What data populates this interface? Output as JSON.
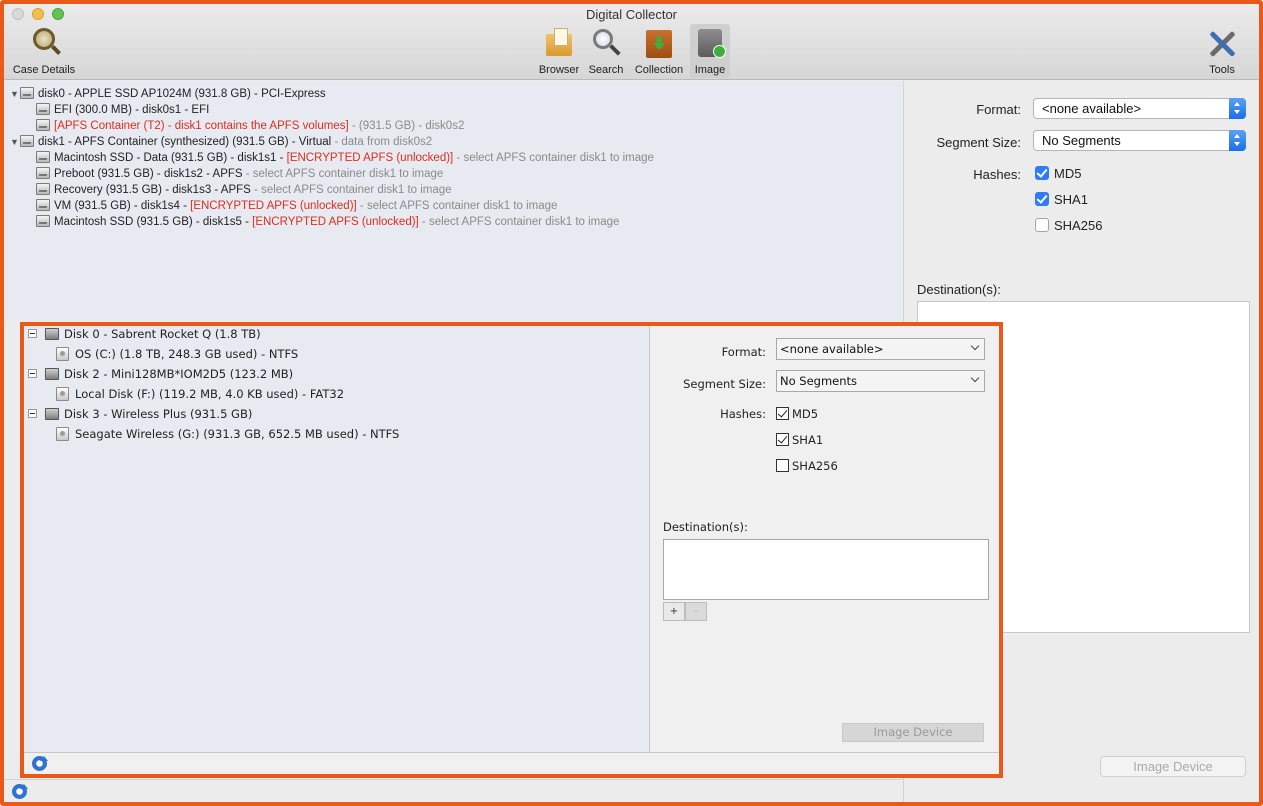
{
  "window": {
    "title": "Digital Collector"
  },
  "toolbar": {
    "case_details": "Case Details",
    "browser": "Browser",
    "search": "Search",
    "collection": "Collection",
    "image": "Image",
    "tools": "Tools",
    "active": "image"
  },
  "mac_tree": {
    "disk0": "disk0 - APPLE SSD AP1024M (931.8 GB) - PCI-Express",
    "efi": "EFI (300.0 MB) - disk0s1 - EFI",
    "apfs_container_red": "[APFS Container (T2) - disk1 contains the APFS volumes]",
    "apfs_container_gray": " -  (931.5 GB) - disk0s2",
    "disk1": "disk1 - APFS Container (synthesized) (931.5 GB) - Virtual",
    "disk1_gray": " - data from disk0s2",
    "rows": [
      {
        "main": "Macintosh SSD - Data (931.5 GB) - disk1s1 - ",
        "red": "[ENCRYPTED APFS (unlocked)]",
        "gray": " - select APFS container disk1 to image"
      },
      {
        "main": "Preboot (931.5 GB) - disk1s2 - APFS",
        "red": "",
        "gray": " - select APFS container disk1 to image"
      },
      {
        "main": "Recovery (931.5 GB) - disk1s3 - APFS",
        "red": "",
        "gray": " - select APFS container disk1 to image"
      },
      {
        "main": "VM (931.5 GB) - disk1s4 - ",
        "red": "[ENCRYPTED APFS (unlocked)]",
        "gray": " - select APFS container disk1 to image"
      },
      {
        "main": "Macintosh SSD (931.5 GB) - disk1s5 - ",
        "red": "[ENCRYPTED APFS (unlocked)]",
        "gray": " - select APFS container disk1 to image"
      }
    ]
  },
  "mac_form": {
    "format_label": "Format:",
    "format_value": "<none available>",
    "segment_label": "Segment Size:",
    "segment_value": "No Segments",
    "hashes_label": "Hashes:",
    "md5": "MD5",
    "sha1": "SHA1",
    "sha256": "SHA256",
    "destinations_label": "Destination(s):",
    "image_device": "Image Device"
  },
  "win_tree": {
    "disk0": "Disk 0 - Sabrent Rocket Q (1.8 TB)",
    "vol_c": "OS (C:) (1.8 TB, 248.3 GB used) - NTFS",
    "disk2": "Disk 2 - Mini128MB*IOM2D5 (123.2 MB)",
    "vol_f": "Local Disk (F:) (119.2 MB, 4.0 KB used) - FAT32",
    "disk3": "Disk 3 - Wireless Plus (931.5 GB)",
    "vol_g": "Seagate Wireless (G:) (931.3 GB, 652.5 MB used) - NTFS"
  },
  "win_form": {
    "format_label": "Format:",
    "format_value": "<none available>",
    "segment_label": "Segment Size:",
    "segment_value": "No Segments",
    "hashes_label": "Hashes:",
    "md5": "MD5",
    "sha1": "SHA1",
    "sha256": "SHA256",
    "destinations_label": "Destination(s):",
    "add": "+",
    "remove": "-",
    "image_device": "Image Device"
  },
  "colors": {
    "frame": "#e8591a",
    "encrypted_text": "#e02d1f",
    "checkbox_accent": "#2f7cf6"
  }
}
